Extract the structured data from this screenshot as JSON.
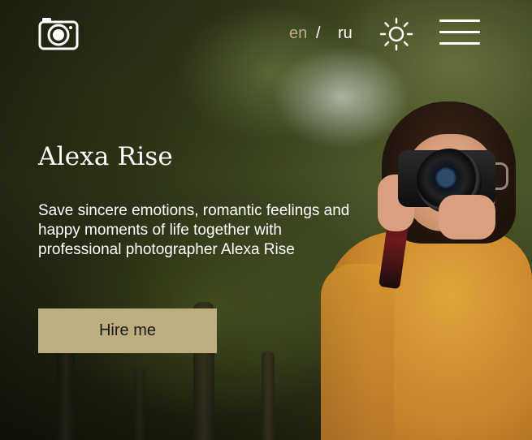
{
  "header": {
    "logo_icon": "camera-icon",
    "languages": [
      {
        "label": "en",
        "active": true
      },
      {
        "label": "ru",
        "active": false
      }
    ],
    "lang_separator": "/",
    "theme_icon": "sun-icon",
    "menu_icon": "hamburger-menu-icon"
  },
  "hero": {
    "title": "Alexa Rise",
    "subtitle": "Save sincere emotions, romantic feelings and happy moments of life together with professional photographer Alexa Rise",
    "cta_label": "Hire me"
  },
  "colors": {
    "accent": "#bdae80",
    "text": "#ffffff"
  }
}
